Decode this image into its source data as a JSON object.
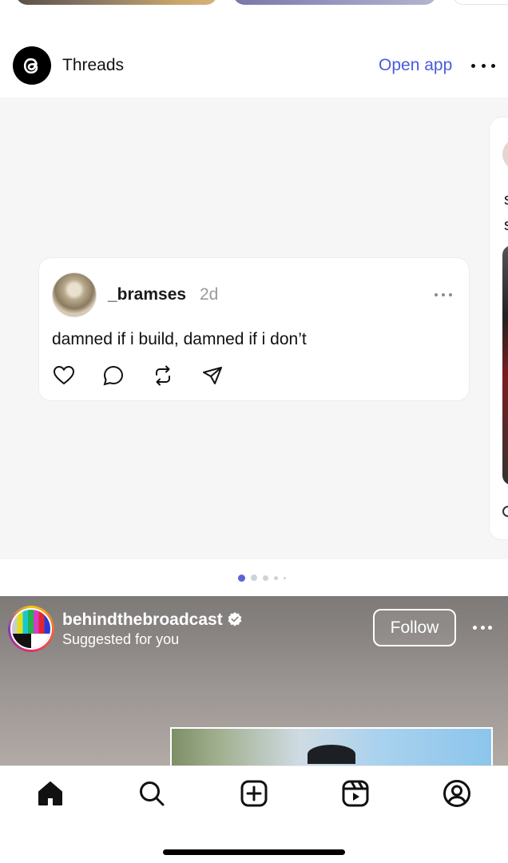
{
  "threads_widget": {
    "app_name": "Threads",
    "open_app_label": "Open app",
    "icons": {
      "logo": "threads-logo-icon",
      "more": "more-horizontal-icon"
    }
  },
  "thread_post": {
    "username": "_bramses",
    "time": "2d",
    "text": "damned if i build, damned if i don’t",
    "actions": [
      "heart-icon",
      "comment-icon",
      "repost-icon",
      "send-icon"
    ]
  },
  "side_post": {
    "line1": "s",
    "line2": "s"
  },
  "carousel": {
    "active_index": 0,
    "dot_count": 5
  },
  "suggested_post": {
    "username": "behindthebroadcast",
    "subtitle": "Suggested for you",
    "follow_label": "Follow",
    "verified": true
  },
  "bottom_nav": {
    "items": [
      "home-icon",
      "search-icon",
      "create-icon",
      "reels-icon",
      "profile-icon"
    ],
    "active": "home-icon"
  },
  "colors": {
    "accent": "#4a5bdc",
    "carousel_bg": "#f5f6f5",
    "active_dot": "#5b63d6"
  }
}
